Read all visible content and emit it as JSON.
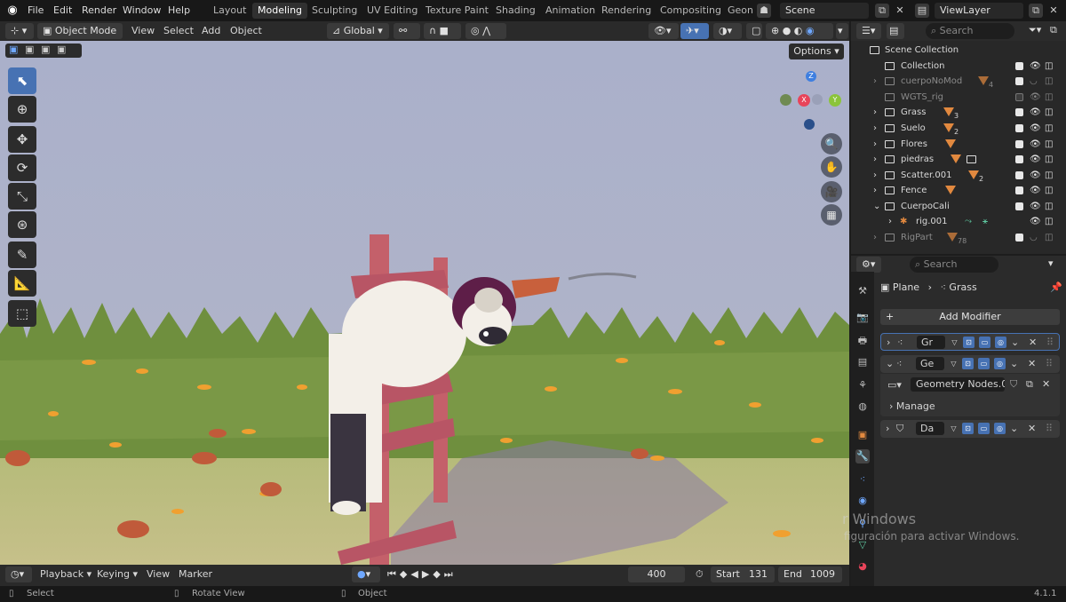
{
  "menu": {
    "file": "File",
    "edit": "Edit",
    "render": "Render",
    "window": "Window",
    "help": "Help"
  },
  "workspaces": [
    {
      "label": "Layout",
      "active": false
    },
    {
      "label": "Modeling",
      "active": true
    },
    {
      "label": "Sculpting",
      "active": false
    },
    {
      "label": "UV Editing",
      "active": false
    },
    {
      "label": "Texture Paint",
      "active": false
    },
    {
      "label": "Shading",
      "active": false
    },
    {
      "label": "Animation",
      "active": false
    },
    {
      "label": "Rendering",
      "active": false
    },
    {
      "label": "Compositing",
      "active": false
    },
    {
      "label": "Geon",
      "active": false
    }
  ],
  "scene": {
    "name": "Scene"
  },
  "view_layer": {
    "name": "ViewLayer"
  },
  "viewport_header": {
    "mode": "Object Mode",
    "view": "View",
    "select": "Select",
    "add": "Add",
    "object": "Object",
    "orientation": "Global",
    "options": "Options"
  },
  "gizmo": {
    "x": "X",
    "y": "Y",
    "z": "Z"
  },
  "timeline": {
    "playback": "Playback",
    "keying": "Keying",
    "view": "View",
    "marker": "Marker",
    "current_frame": "400",
    "start_label": "Start",
    "start": "131",
    "end_label": "End",
    "end": "1009"
  },
  "statusbar": {
    "select": "Select",
    "rotate": "Rotate View",
    "object": "Object",
    "version": "4.1.1"
  },
  "outliner": {
    "search_placeholder": "Search",
    "root": "Scene Collection",
    "rows": [
      {
        "label": "Collection",
        "dim": false,
        "badge": ""
      },
      {
        "label": "cuerpoNoMod",
        "dim": true,
        "badge": "4"
      },
      {
        "label": "WGTS_rig",
        "dim": true,
        "badge": ""
      },
      {
        "label": "Grass",
        "dim": false,
        "badge": "3"
      },
      {
        "label": "Suelo",
        "dim": false,
        "badge": "2"
      },
      {
        "label": "Flores",
        "dim": false,
        "badge": ""
      },
      {
        "label": "piedras",
        "dim": false,
        "badge": ""
      },
      {
        "label": "Scatter.001",
        "dim": false,
        "badge": "2"
      },
      {
        "label": "Fence",
        "dim": false,
        "badge": ""
      },
      {
        "label": "CuerpoCali",
        "dim": false,
        "badge": ""
      },
      {
        "label": "rig.001",
        "dim": false,
        "badge": ""
      },
      {
        "label": "RigPart",
        "dim": true,
        "badge": "78"
      }
    ]
  },
  "properties": {
    "search_placeholder": "Search",
    "breadcrumb_object": "Plane",
    "breadcrumb_data": "Grass",
    "add_modifier": "Add Modifier",
    "modifiers": [
      {
        "name": "Gr",
        "expanded": false
      },
      {
        "name": "Ge",
        "expanded": true
      },
      {
        "name": "Da",
        "expanded": false
      }
    ],
    "node_group": "Geometry Nodes.0...",
    "manage": "Manage"
  },
  "watermark": {
    "line1": "r Windows",
    "line2": "figuración para activar Windows."
  },
  "colors": {
    "accent": "#4772b3",
    "orange": "#e2893f",
    "x_axis": "#e8445a",
    "y_axis": "#8bc43a",
    "z_axis": "#3f7fe0"
  }
}
